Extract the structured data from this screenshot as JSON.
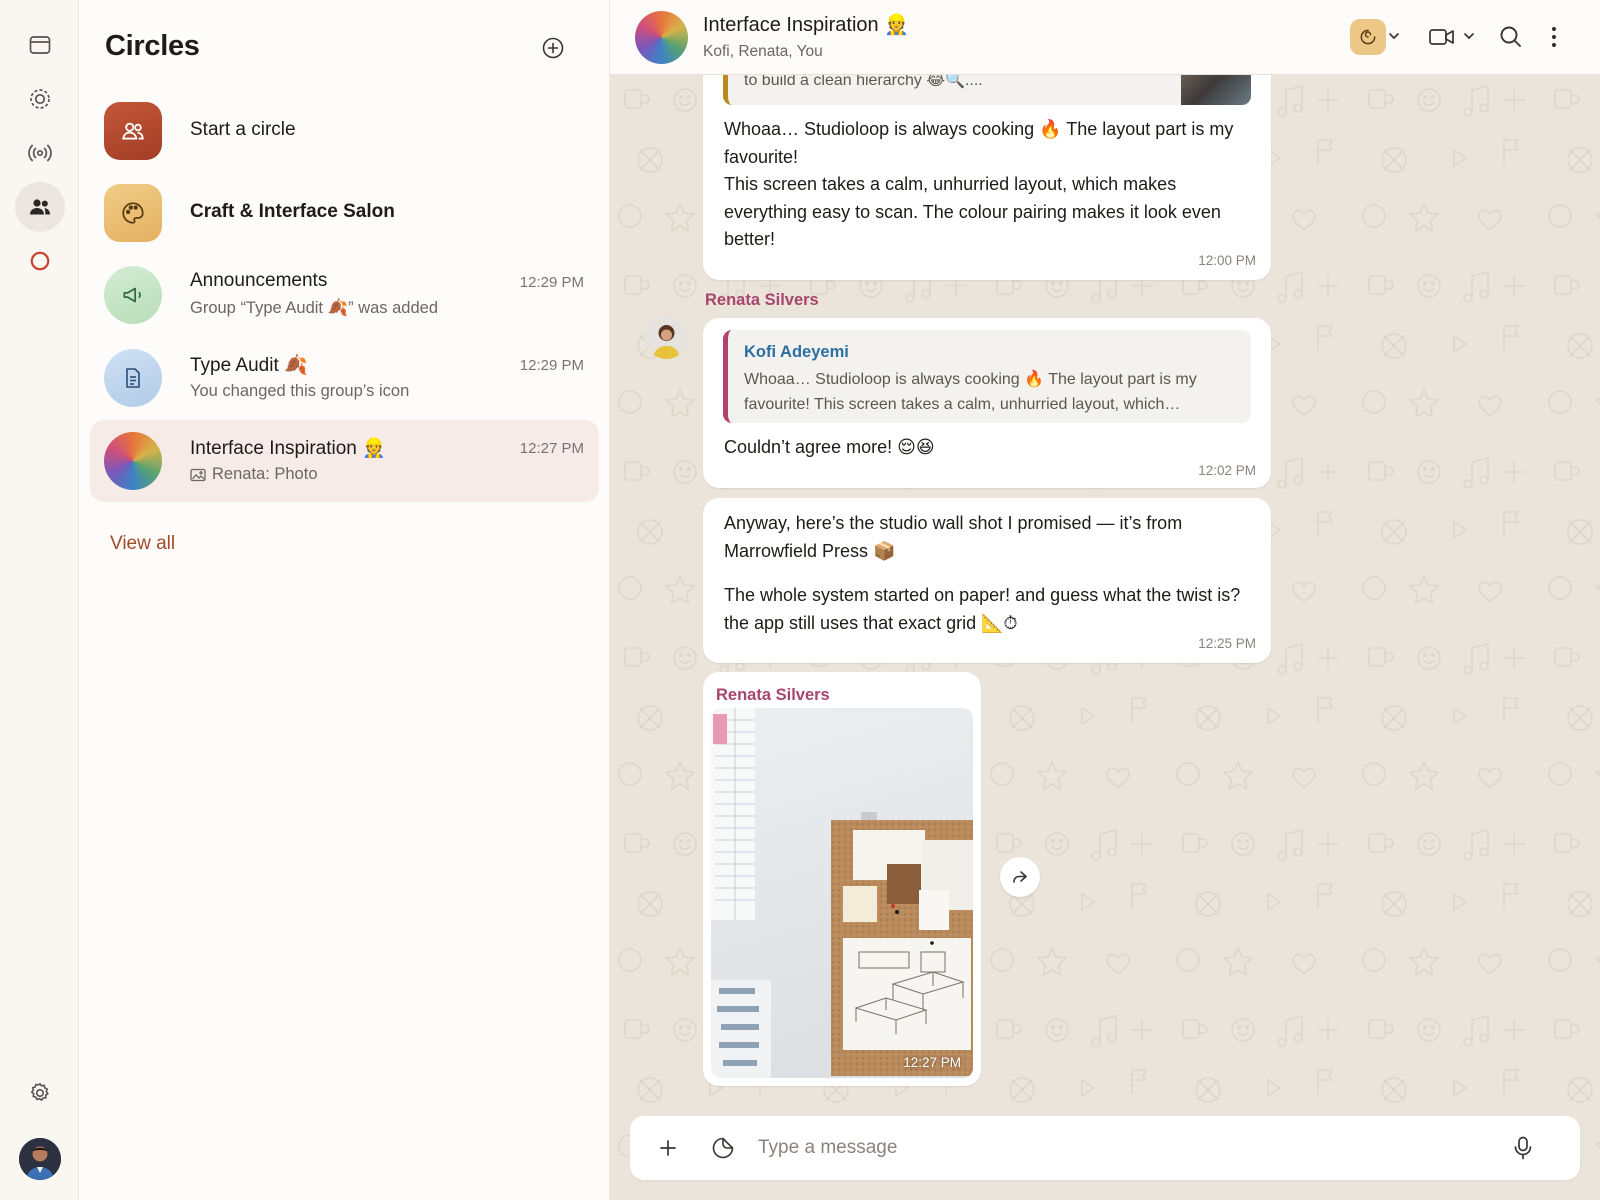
{
  "rail": {
    "items": [
      {
        "icon": "window-icon"
      },
      {
        "icon": "status-icon"
      },
      {
        "icon": "broadcast-icon"
      },
      {
        "icon": "people-icon",
        "active": true
      },
      {
        "icon": "ring-icon"
      }
    ],
    "settings_icon": "gear-icon"
  },
  "list": {
    "title": "Circles",
    "new_icon": "plus-circle-icon",
    "start": {
      "label": "Start a circle"
    },
    "salon": {
      "label": "Craft & Interface Salon"
    },
    "rows": [
      {
        "name": "Announcements",
        "sub": "Group “Type Audit 🍂” was added",
        "time": "12:29 PM"
      },
      {
        "name": "Type Audit 🍂",
        "sub": "You changed this group’s icon",
        "time": "12:29 PM"
      },
      {
        "name": "Interface Inspiration 👷",
        "sub": "Renata: Photo",
        "time": "12:27 PM"
      }
    ],
    "view_all": "View all"
  },
  "chat": {
    "title": "Interface Inspiration 👷",
    "members": "Kofi, Renata, You",
    "top_quote_fragment": "to build a clean hierarchy 😂🔍....",
    "msg1": {
      "p1": "Whoaa… Studioloop is always cooking 🔥 The layout part is my favourite!",
      "p2": "This screen takes a calm, unhurried layout, which makes everything easy to scan. The colour pairing makes it look even better!",
      "time": "12:00 PM"
    },
    "msg2": {
      "sender": "Renata Silvers",
      "quote_name": "Kofi Adeyemi",
      "quote_text": "Whoaa… Studioloop is always cooking 🔥 The layout part is my favourite! This screen takes a calm, unhurried layout, which…",
      "text": "Couldn’t agree more! 😌😆",
      "time": "12:02 PM"
    },
    "msg3": {
      "p1": "Anyway, here’s the studio wall shot I promised — it’s from Marrowfield Press 📦",
      "p2": "The whole system started on paper! and guess what the twist is? the app still uses that exact grid 📐⏱",
      "time": "12:25 PM"
    },
    "msg4": {
      "sender": "Renata Silvers",
      "time": "12:27 PM"
    },
    "composer": {
      "placeholder": "Type a message"
    }
  },
  "colors": {
    "accent": "#a14a28",
    "sender": "#a8456e",
    "quote_name": "#2b6fa3",
    "selected_row": "#f6ebe6",
    "chat_bg": "#ebe4da"
  }
}
